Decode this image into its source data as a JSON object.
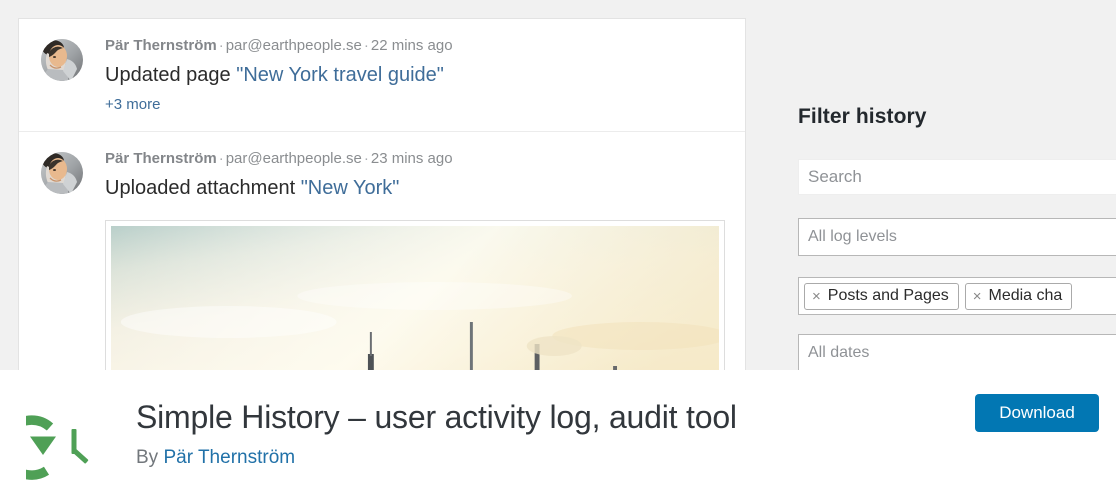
{
  "screenshot": {
    "activity_entries": [
      {
        "avatar": "user-avatar",
        "author": "Pär Thernström",
        "email": "par@earthpeople.se",
        "time": "22 mins ago",
        "action_prefix": "Updated page ",
        "action_target": "\"New York travel guide\"",
        "more_label": "+3 more",
        "has_thumbnail": false,
        "thumbnail_alt": ""
      },
      {
        "avatar": "user-avatar",
        "author": "Pär Thernström",
        "email": "par@earthpeople.se",
        "time": "23 mins ago",
        "action_prefix": "Uploaded attachment ",
        "action_target": "\"New York\"",
        "more_label": "",
        "has_thumbnail": true,
        "thumbnail_alt": "New York city skyline at sunset"
      }
    ],
    "separator": "·",
    "filter_panel": {
      "title": "Filter history",
      "search_placeholder": "Search",
      "log_levels_value": "All log levels",
      "tags": [
        {
          "remove_icon": "×",
          "label": "Posts and Pages"
        },
        {
          "remove_icon": "×",
          "label": "Media cha"
        }
      ],
      "dates_value": "All dates"
    }
  },
  "plugin": {
    "logo_icon": "history-clock-icon",
    "title": "Simple History – user activity log, audit tool",
    "by_label": "By ",
    "author": "Pär Thernström",
    "download_label": "Download"
  },
  "colors": {
    "accent_blue": "#0277b3",
    "link_blue": "#3f6d99",
    "author_blue": "#2171a8",
    "logo_green": "#4fa056",
    "page_bg": "#f1f1f1",
    "card_bg": "#ffffff",
    "title_dark": "#32373c"
  }
}
